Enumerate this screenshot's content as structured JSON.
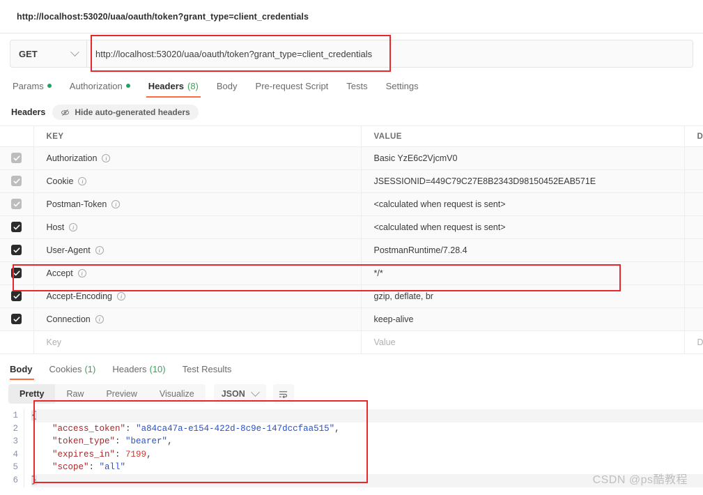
{
  "window": {
    "title": "http://localhost:53020/uaa/oauth/token?grant_type=client_credentials"
  },
  "request": {
    "method": "GET",
    "method_icon": "chevron-down-icon",
    "url": "http://localhost:53020/uaa/oauth/token?grant_type=client_credentials",
    "tabs": [
      {
        "label": "Params",
        "dot": true,
        "count": "",
        "active": false
      },
      {
        "label": "Authorization",
        "dot": true,
        "count": "",
        "active": false
      },
      {
        "label": "Headers",
        "dot": false,
        "count": "(8)",
        "active": true
      },
      {
        "label": "Body",
        "dot": false,
        "count": "",
        "active": false
      },
      {
        "label": "Pre-request Script",
        "dot": false,
        "count": "",
        "active": false
      },
      {
        "label": "Tests",
        "dot": false,
        "count": "",
        "active": false
      },
      {
        "label": "Settings",
        "dot": false,
        "count": "",
        "active": false
      }
    ]
  },
  "headers_panel": {
    "section_label": "Headers",
    "toggle_label": "Hide auto-generated headers",
    "toggle_icon": "eye-slash-icon",
    "columns": [
      "KEY",
      "VALUE",
      "DE"
    ],
    "rows": [
      {
        "checked": true,
        "dim": true,
        "key": "Authorization",
        "value": "Basic YzE6c2VjcmV0",
        "desc": ""
      },
      {
        "checked": true,
        "dim": true,
        "key": "Cookie",
        "value": "JSESSIONID=449C79C27E8B2343D98150452EAB571E",
        "desc": ""
      },
      {
        "checked": true,
        "dim": true,
        "key": "Postman-Token",
        "value": "<calculated when request is sent>",
        "desc": ""
      },
      {
        "checked": true,
        "dim": false,
        "key": "Host",
        "value": "<calculated when request is sent>",
        "desc": ""
      },
      {
        "checked": true,
        "dim": false,
        "key": "User-Agent",
        "value": "PostmanRuntime/7.28.4",
        "desc": ""
      },
      {
        "checked": true,
        "dim": false,
        "key": "Accept",
        "value": "*/*",
        "desc": ""
      },
      {
        "checked": true,
        "dim": false,
        "key": "Accept-Encoding",
        "value": "gzip, deflate, br",
        "desc": ""
      },
      {
        "checked": true,
        "dim": false,
        "key": "Connection",
        "value": "keep-alive",
        "desc": ""
      }
    ],
    "new_row": {
      "key_placeholder": "Key",
      "value_placeholder": "Value",
      "desc_placeholder": "De"
    }
  },
  "response": {
    "tabs": [
      {
        "label": "Body",
        "count": "",
        "active": true
      },
      {
        "label": "Cookies",
        "count": "(1)",
        "active": false
      },
      {
        "label": "Headers",
        "count": "(10)",
        "active": false
      },
      {
        "label": "Test Results",
        "count": "",
        "active": false
      }
    ],
    "view_modes": [
      {
        "label": "Pretty",
        "active": true
      },
      {
        "label": "Raw",
        "active": false
      },
      {
        "label": "Preview",
        "active": false
      },
      {
        "label": "Visualize",
        "active": false
      }
    ],
    "format": "JSON",
    "format_icon": "chevron-down-icon",
    "wrap_icon": "wrap-lines-icon",
    "body_lines": [
      "1",
      "2",
      "3",
      "4",
      "5",
      "6"
    ],
    "body": {
      "open_brace": "{",
      "close_brace": "}",
      "entries": [
        {
          "key": "\"access_token\"",
          "value": "\"a84ca47a-e154-422d-8c9e-147dccfaa515\"",
          "type": "string",
          "comma": ","
        },
        {
          "key": "\"token_type\"",
          "value": "\"bearer\"",
          "type": "string",
          "comma": ","
        },
        {
          "key": "\"expires_in\"",
          "value": "7199",
          "type": "number",
          "comma": ","
        },
        {
          "key": "\"scope\"",
          "value": "\"all\"",
          "type": "string",
          "comma": ""
        }
      ]
    }
  },
  "watermark": "CSDN @ps酷教程",
  "colors": {
    "accent": "#ff6c37",
    "highlight": "#e8272c",
    "green": "#20a464",
    "string": "#2b50c8",
    "key": "#a9262b",
    "number": "#d4382f"
  }
}
